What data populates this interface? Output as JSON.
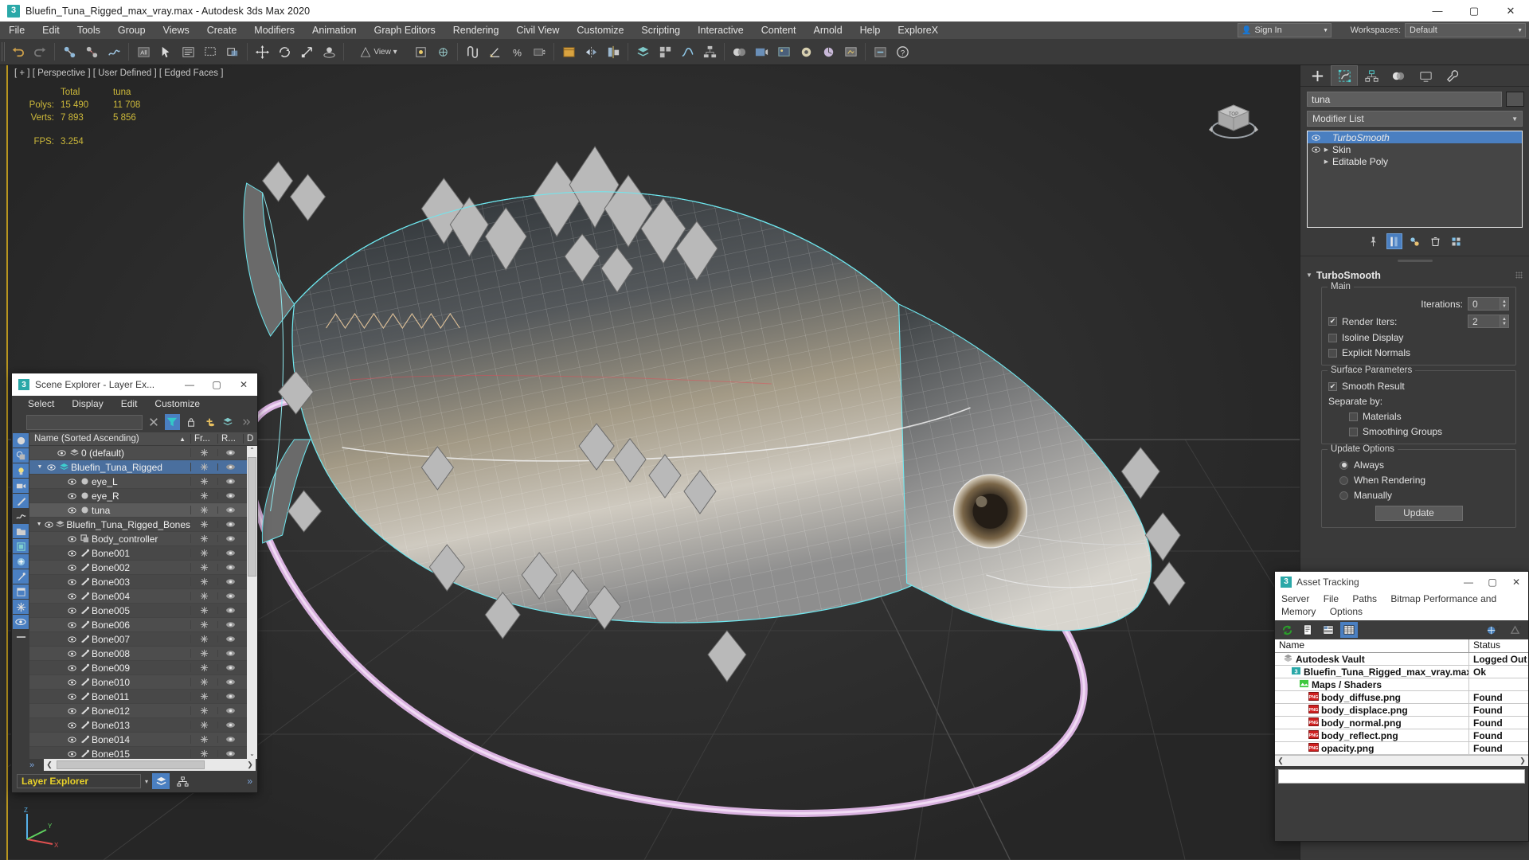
{
  "window": {
    "title": "Bluefin_Tuna_Rigged_max_vray.max - Autodesk 3ds Max 2020",
    "app_badge": "3",
    "minimize": "—",
    "maximize": "▢",
    "close": "✕"
  },
  "menubar": {
    "items": [
      {
        "label": "File"
      },
      {
        "label": "Edit"
      },
      {
        "label": "Tools"
      },
      {
        "label": "Group"
      },
      {
        "label": "Views"
      },
      {
        "label": "Create"
      },
      {
        "label": "Modifiers"
      },
      {
        "label": "Animation"
      },
      {
        "label": "Graph Editors"
      },
      {
        "label": "Rendering"
      },
      {
        "label": "Civil View"
      },
      {
        "label": "Customize"
      },
      {
        "label": "Scripting"
      },
      {
        "label": "Interactive"
      },
      {
        "label": "Content"
      },
      {
        "label": "Arnold"
      },
      {
        "label": "Help"
      },
      {
        "label": "ExploreX"
      }
    ],
    "sign_in": "Sign In",
    "workspaces_label": "Workspaces:",
    "workspace_value": "Default"
  },
  "toolbar": {
    "icons": [
      "undo-icon",
      "redo-icon",
      "select-link-icon",
      "unlink-icon",
      "bind-space-warp-icon",
      "selection-filter-icon",
      "select-object-icon",
      "select-by-name-icon",
      "select-region-icon",
      "window-crossing-icon",
      "select-and-move-icon",
      "select-and-rotate-icon",
      "select-and-scale-icon",
      "placement-icon",
      "reference-coordinate-icon",
      "use-pivot-icon",
      "select-and-manipulate-icon",
      "snaps-toggle-icon",
      "angle-snap-icon",
      "percent-snap-icon",
      "spinner-snap-icon",
      "named-selection-icon",
      "mirror-icon",
      "align-icon",
      "layer-explorer-icon",
      "curve-editor-icon",
      "schematic-view-icon",
      "material-editor-icon",
      "render-setup-icon",
      "rendered-frame-icon",
      "render-production-icon",
      "render-iterative-icon",
      "activeshade-icon",
      "help-icon"
    ]
  },
  "viewport": {
    "label": "[ + ] [ Perspective ] [ User Defined ] [ Edged Faces ]",
    "stats": {
      "col_total": "Total",
      "col_object": "tuna",
      "polys_label": "Polys:",
      "polys_total": "15 490",
      "polys_obj": "11 708",
      "verts_label": "Verts:",
      "verts_total": "7 893",
      "verts_obj": "5 856",
      "fps_label": "FPS:",
      "fps_value": "3.254"
    },
    "colors": {
      "stats_text": "#ccb83a",
      "selection_highlight": "#45e0e0",
      "spline_controller": "#e0b8e8"
    }
  },
  "command_panel": {
    "tabs": [
      {
        "name": "create-tab",
        "icon": "plus-icon",
        "active": false
      },
      {
        "name": "modify-tab",
        "icon": "modify-icon",
        "active": true
      },
      {
        "name": "hierarchy-tab",
        "icon": "hierarchy-icon",
        "active": false
      },
      {
        "name": "motion-tab",
        "icon": "motion-icon",
        "active": false
      },
      {
        "name": "display-tab",
        "icon": "display-icon",
        "active": false
      },
      {
        "name": "utilities-tab",
        "icon": "wrench-icon",
        "active": false
      }
    ],
    "object_name": "tuna",
    "modifier_list_label": "Modifier List",
    "stack": [
      {
        "name": "TurboSmooth",
        "selected": true,
        "has_eye": true,
        "expandable": false
      },
      {
        "name": "Skin",
        "selected": false,
        "has_eye": true,
        "expandable": true
      },
      {
        "name": "Editable Poly",
        "selected": false,
        "has_eye": false,
        "expandable": true
      }
    ],
    "stack_tools": [
      "pin-stack-icon",
      "show-end-result-icon",
      "make-unique-icon",
      "remove-modifier-icon",
      "configure-sets-icon"
    ],
    "rollout": {
      "title": "TurboSmooth",
      "main": {
        "group_label": "Main",
        "iterations_label": "Iterations:",
        "iterations_value": "0",
        "render_iters_label": "Render Iters:",
        "render_iters_checked": true,
        "render_iters_value": "2",
        "isoline_display_label": "Isoline Display",
        "isoline_display_checked": false,
        "explicit_normals_label": "Explicit Normals",
        "explicit_normals_checked": false
      },
      "surface": {
        "group_label": "Surface Parameters",
        "smooth_result_label": "Smooth Result",
        "smooth_result_checked": true,
        "separate_by_label": "Separate by:",
        "materials_label": "Materials",
        "materials_checked": false,
        "smoothing_groups_label": "Smoothing Groups",
        "smoothing_groups_checked": false
      },
      "update": {
        "group_label": "Update Options",
        "always_label": "Always",
        "when_rendering_label": "When Rendering",
        "manually_label": "Manually",
        "selected": "Always",
        "update_button": "Update"
      }
    }
  },
  "scene_explorer": {
    "title": "Scene Explorer - Layer Ex...",
    "badge": "3",
    "minimize": "—",
    "maximize": "▢",
    "close": "✕",
    "menu": [
      "Select",
      "Display",
      "Edit",
      "Customize"
    ],
    "search_value": "",
    "columns": {
      "name": "Name (Sorted Ascending)",
      "sort_arrow": "▲",
      "frozen": "Fr...",
      "render": "R...",
      "d": "D"
    },
    "rows": [
      {
        "label": "0 (default)",
        "depth": 1,
        "icon": "layer-icon",
        "expand": "",
        "eye": true,
        "state": ""
      },
      {
        "label": "Bluefin_Tuna_Rigged",
        "depth": 0,
        "icon": "layer-icon-active",
        "expand": "▼",
        "eye": true,
        "state": "sel"
      },
      {
        "label": "eye_L",
        "depth": 2,
        "icon": "object-icon",
        "expand": "",
        "eye": true,
        "state": ""
      },
      {
        "label": "eye_R",
        "depth": 2,
        "icon": "object-icon",
        "expand": "",
        "eye": true,
        "state": ""
      },
      {
        "label": "tuna",
        "depth": 2,
        "icon": "object-icon",
        "expand": "",
        "eye": true,
        "state": "hl"
      },
      {
        "label": "Bluefin_Tuna_Rigged_Bones",
        "depth": 0,
        "icon": "layer-icon",
        "expand": "▼",
        "eye": true,
        "state": ""
      },
      {
        "label": "Body_controller",
        "depth": 2,
        "icon": "shape-icon",
        "expand": "",
        "eye": true,
        "state": ""
      },
      {
        "label": "Bone001",
        "depth": 2,
        "icon": "bone-icon",
        "expand": "",
        "eye": true,
        "state": ""
      },
      {
        "label": "Bone002",
        "depth": 2,
        "icon": "bone-icon",
        "expand": "",
        "eye": true,
        "state": ""
      },
      {
        "label": "Bone003",
        "depth": 2,
        "icon": "bone-icon",
        "expand": "",
        "eye": true,
        "state": ""
      },
      {
        "label": "Bone004",
        "depth": 2,
        "icon": "bone-icon",
        "expand": "",
        "eye": true,
        "state": ""
      },
      {
        "label": "Bone005",
        "depth": 2,
        "icon": "bone-icon",
        "expand": "",
        "eye": true,
        "state": ""
      },
      {
        "label": "Bone006",
        "depth": 2,
        "icon": "bone-icon",
        "expand": "",
        "eye": true,
        "state": ""
      },
      {
        "label": "Bone007",
        "depth": 2,
        "icon": "bone-icon",
        "expand": "",
        "eye": true,
        "state": ""
      },
      {
        "label": "Bone008",
        "depth": 2,
        "icon": "bone-icon",
        "expand": "",
        "eye": true,
        "state": ""
      },
      {
        "label": "Bone009",
        "depth": 2,
        "icon": "bone-icon",
        "expand": "",
        "eye": true,
        "state": ""
      },
      {
        "label": "Bone010",
        "depth": 2,
        "icon": "bone-icon",
        "expand": "",
        "eye": true,
        "state": ""
      },
      {
        "label": "Bone011",
        "depth": 2,
        "icon": "bone-icon",
        "expand": "",
        "eye": true,
        "state": ""
      },
      {
        "label": "Bone012",
        "depth": 2,
        "icon": "bone-icon",
        "expand": "",
        "eye": true,
        "state": ""
      },
      {
        "label": "Bone013",
        "depth": 2,
        "icon": "bone-icon",
        "expand": "",
        "eye": true,
        "state": ""
      },
      {
        "label": "Bone014",
        "depth": 2,
        "icon": "bone-icon",
        "expand": "",
        "eye": true,
        "state": ""
      },
      {
        "label": "Bone015",
        "depth": 2,
        "icon": "bone-icon",
        "expand": "",
        "eye": true,
        "state": ""
      }
    ],
    "side_buttons": [
      "all-icon",
      "geometry-icon",
      "lights-icon",
      "cameras-icon",
      "helpers-icon",
      "space-warps-icon",
      "groups-icon",
      "xrefs-icon",
      "bones-icon",
      "containers-icon",
      "particles-icon",
      "visibility-icon",
      "selection-icon",
      "freeze-icon"
    ],
    "footer": {
      "layer_explorer": "Layer Explorer",
      "dropdown_arrow": "▾",
      "buttons": [
        "layer-list-icon",
        "hierarchy-view-icon"
      ],
      "overflow": "»"
    },
    "scroll": {
      "left": "❮",
      "right": "❯",
      "up": "⌃",
      "down": "⌄"
    }
  },
  "asset_tracking": {
    "title": "Asset Tracking",
    "badge": "3",
    "minimize": "—",
    "maximize": "▢",
    "close": "✕",
    "menu": [
      "Server",
      "File",
      "Paths",
      "Bitmap Performance and Memory",
      "Options"
    ],
    "toolbar_icons": [
      "refresh-icon",
      "list-view-icon",
      "detail-view-icon",
      "grid-view-icon",
      "add-network-icon",
      "query-icon"
    ],
    "columns": {
      "name": "Name",
      "status": "Status"
    },
    "rows": [
      {
        "name": "Autodesk Vault",
        "status": "Logged Out",
        "depth": 0,
        "icon": "vault-icon"
      },
      {
        "name": "Bluefin_Tuna_Rigged_max_vray.max",
        "status": "Ok",
        "depth": 1,
        "icon": "max-file-icon"
      },
      {
        "name": "Maps / Shaders",
        "status": "",
        "depth": 2,
        "icon": "maps-icon"
      },
      {
        "name": "body_diffuse.png",
        "status": "Found",
        "depth": 3,
        "icon": "png-icon"
      },
      {
        "name": "body_displace.png",
        "status": "Found",
        "depth": 3,
        "icon": "png-icon"
      },
      {
        "name": "body_normal.png",
        "status": "Found",
        "depth": 3,
        "icon": "png-icon"
      },
      {
        "name": "body_reflect.png",
        "status": "Found",
        "depth": 3,
        "icon": "png-icon"
      },
      {
        "name": "opacity.png",
        "status": "Found",
        "depth": 3,
        "icon": "png-icon"
      }
    ],
    "scroll": {
      "left": "❮",
      "right": "❯"
    }
  }
}
